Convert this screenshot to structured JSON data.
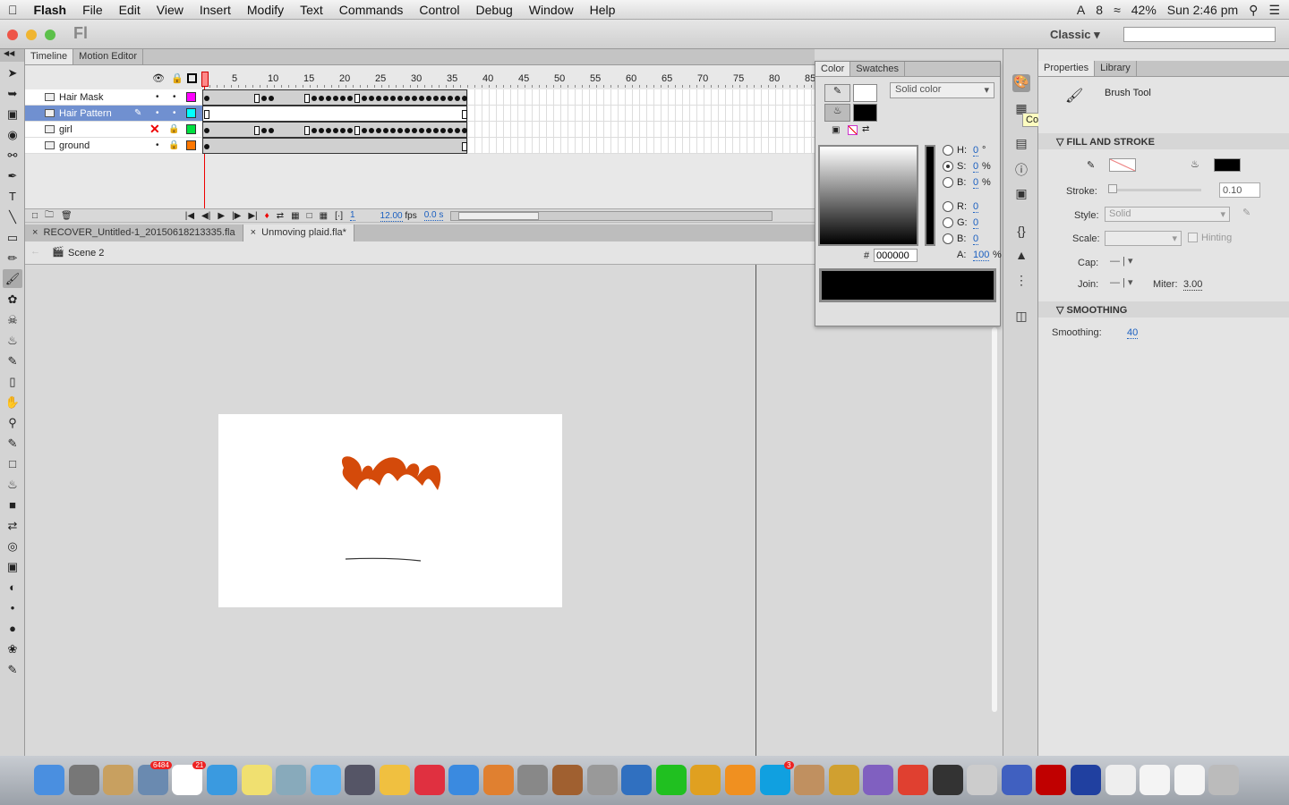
{
  "menubar": {
    "app": "Flash",
    "items": [
      "File",
      "Edit",
      "View",
      "Insert",
      "Modify",
      "Text",
      "Commands",
      "Control",
      "Debug",
      "Window",
      "Help"
    ],
    "status": {
      "adobe_count": "8",
      "battery": "42%",
      "clock": "Sun 2:46 pm"
    }
  },
  "titlebar": {
    "logo": "Fl",
    "workspace": "Classic",
    "search_placeholder": ""
  },
  "timeline": {
    "tabs": [
      "Timeline",
      "Motion Editor"
    ],
    "ruler": [
      1,
      5,
      10,
      15,
      20,
      25,
      30,
      35,
      40,
      45,
      50,
      55,
      60,
      65,
      70,
      75,
      80,
      85
    ],
    "layers": [
      {
        "name": "Hair Mask",
        "color": "#ff00ff",
        "selected": false,
        "hidden": false,
        "locked": false,
        "keyframes": [
          1,
          9,
          10,
          16,
          17,
          18,
          19,
          20,
          21,
          23,
          24,
          25,
          26,
          27,
          28,
          29,
          30,
          31,
          32,
          33,
          34,
          35,
          36,
          37
        ],
        "empty_keyframes": [
          8,
          15,
          22
        ]
      },
      {
        "name": "Hair Pattern",
        "color": "#00ffff",
        "selected": true,
        "hidden": false,
        "locked": false,
        "keyframes": [],
        "empty_keyframes": [
          1,
          37
        ]
      },
      {
        "name": "girl",
        "color": "#00e040",
        "selected": false,
        "hidden": true,
        "locked": true,
        "keyframes": [
          1,
          9,
          10,
          16,
          17,
          18,
          19,
          20,
          21,
          23,
          24,
          25,
          26,
          27,
          28,
          29,
          30,
          31,
          32,
          33,
          34,
          35,
          36,
          37
        ],
        "empty_keyframes": [
          8,
          15,
          22
        ]
      },
      {
        "name": "ground",
        "color": "#ff7700",
        "selected": false,
        "hidden": false,
        "locked": true,
        "keyframes": [
          1
        ],
        "empty_keyframes": [
          37
        ]
      }
    ],
    "current_frame": "1",
    "fps": "12.00",
    "fps_unit": "fps",
    "time": "0.0 s",
    "total_frames": 37
  },
  "documents": {
    "tabs": [
      "RECOVER_Untitled-1_20150618213335.fla",
      "Unmoving plaid.fla*"
    ],
    "active": 1,
    "scene": "Scene 2"
  },
  "color_panel": {
    "tabs": [
      "Color",
      "Swatches"
    ],
    "type": "Solid color",
    "h": "0",
    "h_unit": "°",
    "s": "0",
    "b": "0",
    "pct": "%",
    "r": "0",
    "g": "0",
    "b2": "0",
    "hex_label": "#",
    "hex": "000000",
    "alpha": "100",
    "alpha_unit": "%",
    "labels": {
      "h": "H:",
      "s": "S:",
      "b": "B:",
      "r": "R:",
      "g": "G:",
      "b2": "B:",
      "a": "A:"
    },
    "selected_mode": "S",
    "stroke_color": "#ffffff",
    "fill_color": "#000000"
  },
  "tooltip": "Color",
  "properties": {
    "tabs": [
      "Properties",
      "Library"
    ],
    "tool": "Brush Tool",
    "fill_stroke": {
      "title": "FILL AND STROKE",
      "stroke_label": "Stroke:",
      "stroke_value": "0.10",
      "style_label": "Style:",
      "style_value": "Solid",
      "scale_label": "Scale:",
      "hinting": "Hinting",
      "cap_label": "Cap:",
      "join_label": "Join:",
      "miter_label": "Miter:",
      "miter_value": "3.00",
      "fill_color": "#000000"
    },
    "smoothing": {
      "title": "SMOOTHING",
      "label": "Smoothing:",
      "value": "40"
    }
  },
  "dock": {
    "icons": [
      {
        "name": "finder",
        "color": "#4a8fe0"
      },
      {
        "name": "launchpad",
        "color": "#777"
      },
      {
        "name": "contacts",
        "color": "#c8a060"
      },
      {
        "name": "mail-stamp",
        "color": "#6a8ab0",
        "badge": "6484"
      },
      {
        "name": "calendar",
        "color": "#fff",
        "badge": "21"
      },
      {
        "name": "safari",
        "color": "#3a9ae0"
      },
      {
        "name": "stickies",
        "color": "#f0e070"
      },
      {
        "name": "preview",
        "color": "#8ab"
      },
      {
        "name": "messages",
        "color": "#5ab0f0"
      },
      {
        "name": "facetime",
        "color": "#556"
      },
      {
        "name": "textedit",
        "color": "#f0c040"
      },
      {
        "name": "itunes",
        "color": "#e03040"
      },
      {
        "name": "app-store",
        "color": "#3a8ae0"
      },
      {
        "name": "ibooks-chart",
        "color": "#e08030"
      },
      {
        "name": "system-prefs",
        "color": "#888"
      },
      {
        "name": "garageband",
        "color": "#a06030"
      },
      {
        "name": "photo",
        "color": "#999"
      },
      {
        "name": "keynote",
        "color": "#3070c0"
      },
      {
        "name": "creative-cloud",
        "color": "#20c020"
      },
      {
        "name": "chrome-like",
        "color": "#e0a020"
      },
      {
        "name": "ibooks",
        "color": "#f09020"
      },
      {
        "name": "skype",
        "color": "#10a0e0",
        "badge": "3"
      },
      {
        "name": "package",
        "color": "#c09060"
      },
      {
        "name": "archive",
        "color": "#d0a030"
      },
      {
        "name": "imovie",
        "color": "#8060c0"
      },
      {
        "name": "chrome",
        "color": "#e04030"
      },
      {
        "name": "activity-monitor",
        "color": "#333"
      },
      {
        "name": "script-editor",
        "color": "#ccc"
      },
      {
        "name": "network",
        "color": "#4060c0"
      },
      {
        "name": "flash",
        "color": "#c00000"
      },
      {
        "name": "audition",
        "color": "#2040a0"
      },
      {
        "name": "pdf",
        "color": "#eee"
      },
      {
        "name": "downloads",
        "color": "#f4f4f4"
      },
      {
        "name": "documents",
        "color": "#f4f4f4"
      },
      {
        "name": "trash",
        "color": "#bbb"
      }
    ]
  }
}
